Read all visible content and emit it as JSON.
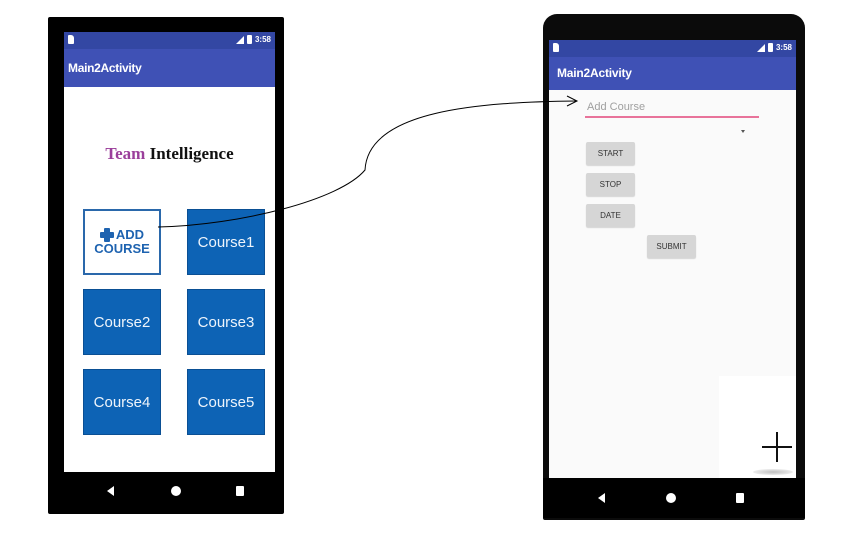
{
  "left_screen": {
    "status_bar": {
      "time": "3:58"
    },
    "app_bar": {
      "title": "Main2Activity"
    },
    "brand": {
      "word1": "Team",
      "word2": "Intelligence",
      "word1_color": "#9b3f9b",
      "word2_color": "#111111"
    },
    "tiles": [
      {
        "line1": "ADD",
        "line2": "COURSE",
        "icon": "plus-icon"
      },
      {
        "label": "Course1"
      },
      {
        "label": "Course2"
      },
      {
        "label": "Course3"
      },
      {
        "label": "Course4"
      },
      {
        "label": "Course5"
      }
    ],
    "nav": [
      "back",
      "home",
      "recents"
    ]
  },
  "right_screen": {
    "status_bar": {
      "time": "3:58"
    },
    "app_bar": {
      "title": "Main2Activity"
    },
    "course_input": {
      "placeholder": "Add Course",
      "value": ""
    },
    "buttons": {
      "start": "START",
      "stop": "STOP",
      "date": "DATE",
      "submit": "SUBMIT"
    },
    "fab": {
      "icon": "plus-icon"
    },
    "nav": [
      "back",
      "home",
      "recents"
    ]
  },
  "colors": {
    "primary": "#3f51b5",
    "primary_dark": "#3347a3",
    "tile_blue": "#0d63b5",
    "input_accent": "#e8739a"
  }
}
